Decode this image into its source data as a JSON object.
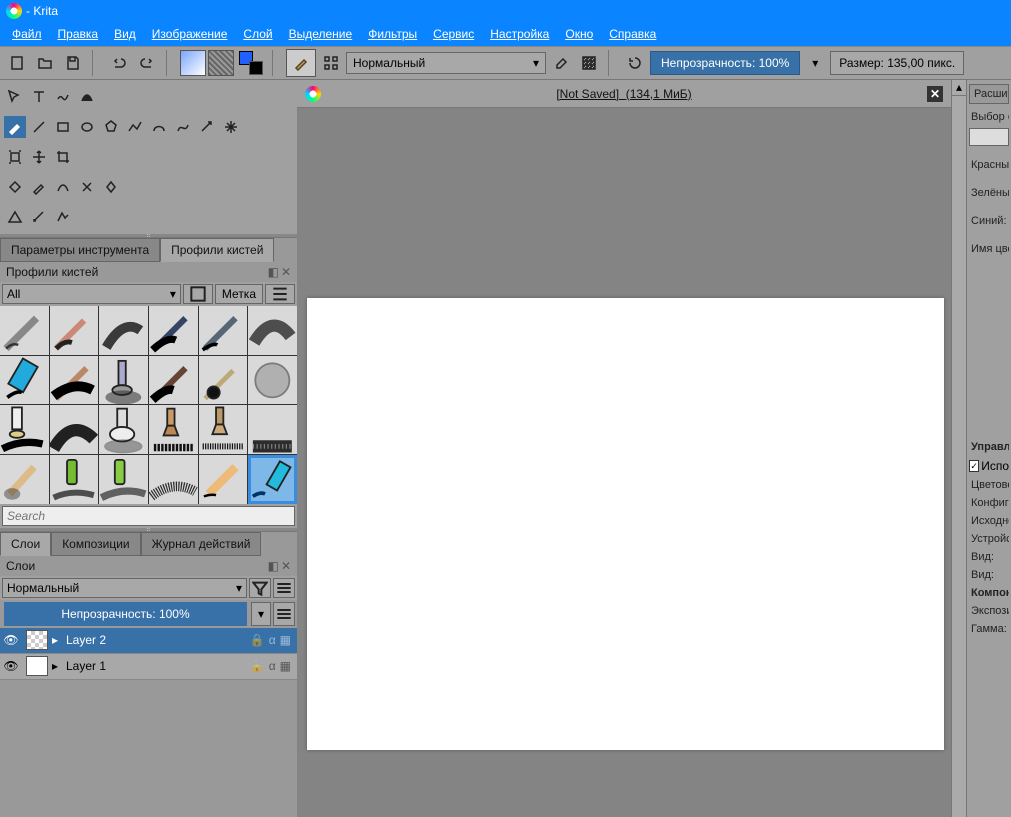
{
  "titlebar": {
    "title": " - Krita"
  },
  "menubar": [
    "Файл",
    "Правка",
    "Вид",
    "Изображение",
    "Слой",
    "Выделение",
    "Фильтры",
    "Сервис",
    "Настройка",
    "Окно",
    "Справка"
  ],
  "toolbar": {
    "blend_mode": "Нормальный",
    "opacity_label": "Непрозрачность: 100%",
    "size_label": "Размер: 135,00 пикс."
  },
  "doc_tab": {
    "title": "[Not Saved]",
    "size": "(134,1 МиБ)"
  },
  "docker_tabs_top": {
    "tool_options": "Параметры инструмента",
    "brush_presets": "Профили кистей"
  },
  "brush_docker": {
    "title": "Профили кистей",
    "filter_all": "All",
    "filter_tag": "Метка",
    "search_placeholder": "Search"
  },
  "docker_tabs_bottom": {
    "layers": "Слои",
    "compositions": "Композиции",
    "undo": "Журнал действий"
  },
  "layers_docker": {
    "title": "Слои",
    "blend": "Нормальный",
    "opacity": "Непрозрачность:  100%",
    "layers": [
      {
        "name": "Layer 2",
        "selected": true,
        "checker": true
      },
      {
        "name": "Layer 1",
        "selected": false,
        "checker": false
      }
    ]
  },
  "right_panel": {
    "tab": "Расши",
    "select_label": "Выбор о",
    "channels": [
      "Красный",
      "Зелёный",
      "Синий:",
      "Имя цве"
    ],
    "mgmt": "Управле",
    "use_check": "Испо",
    "items": [
      "Цветово",
      "Конфиг",
      "Исходно",
      "Устройс",
      "Вид:",
      "Вид:",
      "Компон",
      "Экспози",
      "Гамма:"
    ]
  }
}
